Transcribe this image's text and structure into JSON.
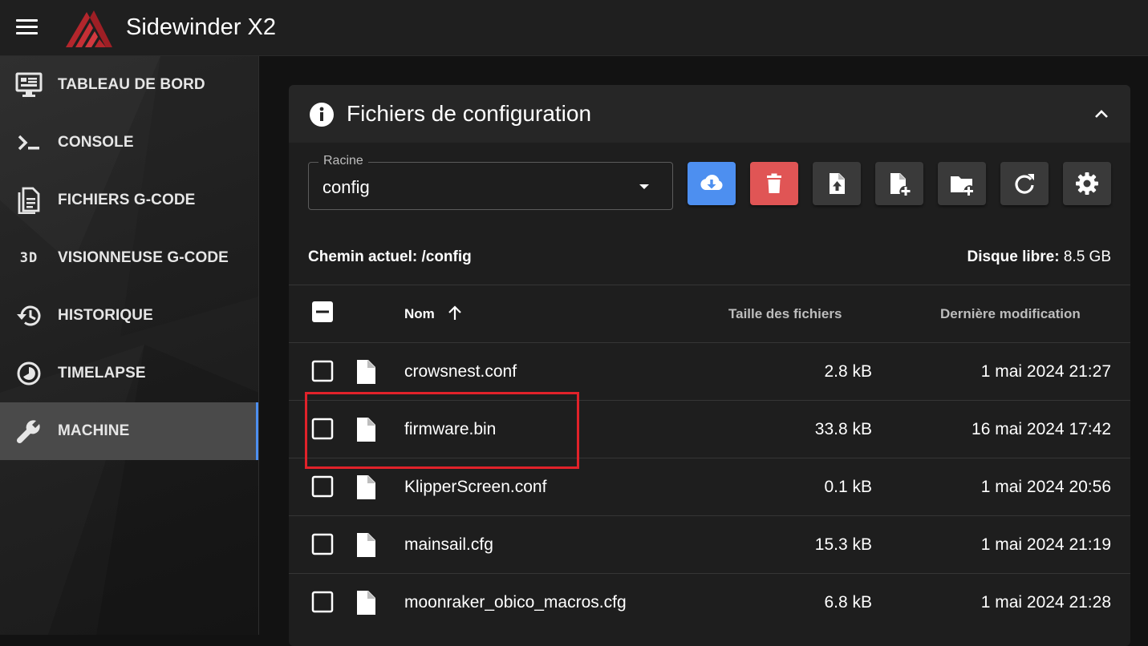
{
  "app": {
    "title": "Sidewinder X2"
  },
  "sidebar": {
    "items": [
      {
        "label": "TABLEAU DE BORD",
        "icon": "monitor-dashboard-icon",
        "active": false
      },
      {
        "label": "CONSOLE",
        "icon": "console-icon",
        "active": false
      },
      {
        "label": "FICHIERS G-CODE",
        "icon": "file-document-icon",
        "active": false
      },
      {
        "label": "VISIONNEUSE G-CODE",
        "icon": "3d-icon",
        "active": false
      },
      {
        "label": "HISTORIQUE",
        "icon": "history-icon",
        "active": false
      },
      {
        "label": "TIMELAPSE",
        "icon": "timelapse-icon",
        "active": false
      },
      {
        "label": "MACHINE",
        "icon": "wrench-icon",
        "active": true
      }
    ],
    "icon_3d_text": "3D",
    "active_color": "#4d8ff0"
  },
  "card": {
    "title": "Fichiers de configuration",
    "root_label": "Racine",
    "root_value": "config",
    "toolbar": [
      "download-cloud-icon",
      "delete-icon",
      "upload-file-icon",
      "new-file-icon",
      "new-folder-icon",
      "refresh-icon",
      "settings-icon"
    ],
    "download_color": "#4d8ff0",
    "delete_color": "#e05555",
    "path_label": "Chemin actuel:",
    "path_value": "/config",
    "disk_label": "Disque libre:",
    "disk_value": "8.5 GB"
  },
  "table": {
    "columns": {
      "name": "Nom",
      "size": "Taille des fichiers",
      "date": "Dernière modification"
    },
    "rows": [
      {
        "name": "crowsnest.conf",
        "size": "2.8 kB",
        "date": "1 mai 2024 21:27"
      },
      {
        "name": "firmware.bin",
        "size": "33.8 kB",
        "date": "16 mai 2024 17:42"
      },
      {
        "name": "KlipperScreen.conf",
        "size": "0.1 kB",
        "date": "1 mai 2024 20:56"
      },
      {
        "name": "mainsail.cfg",
        "size": "15.3 kB",
        "date": "1 mai 2024 21:19"
      },
      {
        "name": "moonraker_obico_macros.cfg",
        "size": "6.8 kB",
        "date": "1 mai 2024 21:28"
      }
    ]
  },
  "annotation": {
    "highlight_color": "#e1222a"
  }
}
